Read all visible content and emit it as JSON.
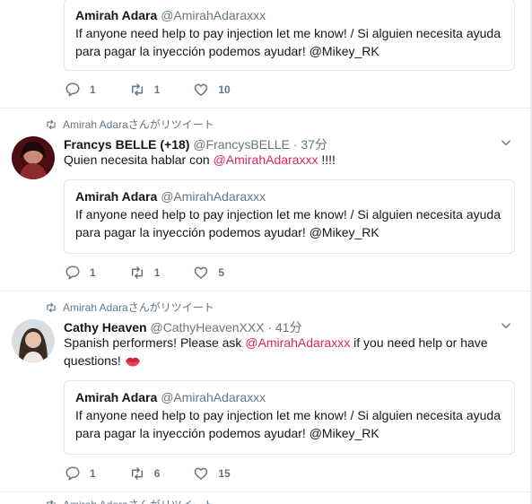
{
  "quoted": {
    "name": "Amirah Adara",
    "handle": "@AmirahAdaraxxx",
    "text": "If anyone need help to pay injection let me know! / Si alguien necesita ayuda para pagar la inyección podemos ayudar! @Mikey_RK"
  },
  "tweets": [
    {
      "actions": {
        "reply": "1",
        "retweet": "1",
        "like": "10"
      }
    },
    {
      "retweeted_by": "Amirah Adaraさんがリツイート",
      "name": "Francys BELLE (+18)",
      "handle": "@FrancysBELLE",
      "dot": "·",
      "time": "37分",
      "text_before": "Quien necesita hablar con ",
      "mention": "@AmirahAdaraxxx",
      "text_after": " !!!!",
      "actions": {
        "reply": "1",
        "retweet": "1",
        "like": "5"
      }
    },
    {
      "retweeted_by": "Amirah Adaraさんがリツイート",
      "name": "Cathy Heaven",
      "handle": "@CathyHeavenXXX",
      "dot": "·",
      "time": "41分",
      "text_before": "Spanish performers! Please ask ",
      "mention": "@AmirahAdaraxxx",
      "text_after": " if you need help or have questions!",
      "actions": {
        "reply": "1",
        "retweet": "6",
        "like": "15"
      }
    },
    {
      "retweeted_by": "Amirah Adaraさんがリツイート"
    }
  ],
  "colors": {
    "mention": "#e0245e",
    "muted": "#657786",
    "border": "#e6ecf0"
  },
  "icons": {
    "reply": "reply-icon",
    "retweet": "retweet-icon",
    "like": "heart-icon",
    "caret": "chevron-down-icon",
    "emoji": "kiss-mark-icon"
  }
}
